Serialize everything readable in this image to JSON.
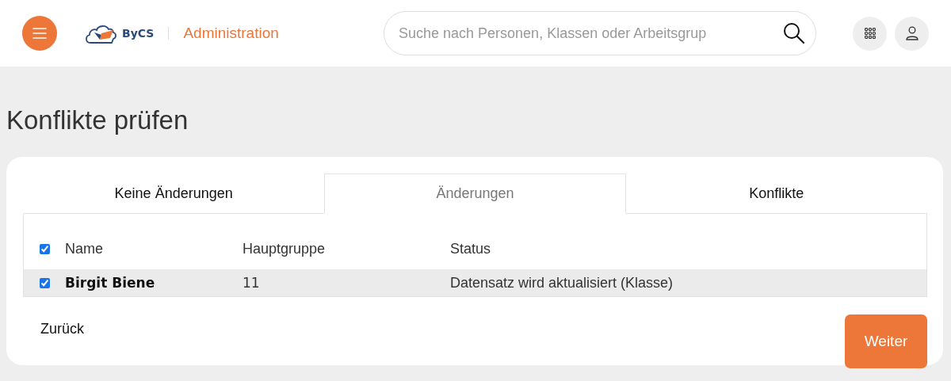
{
  "header": {
    "logo_text": "ByCS",
    "app_title": "Administration",
    "search": {
      "placeholder": "Suche nach Personen, Klassen oder Arbeitsgrup"
    }
  },
  "page_title": "Konflikte prüfen",
  "tabs": [
    {
      "label": "Keine Änderungen",
      "selected": false
    },
    {
      "label": "Änderungen",
      "selected": true
    },
    {
      "label": "Konflikte",
      "selected": false
    }
  ],
  "table": {
    "select_all": {
      "checked": true
    },
    "columns": [
      "Name",
      "Hauptgruppe",
      "Status"
    ],
    "rows": [
      {
        "checked": true,
        "cells": [
          "Birgit Biene",
          "11",
          "Datensatz wird aktualisiert (Klasse)"
        ]
      }
    ]
  },
  "buttons": {
    "back": "Zurück",
    "next": "Weiter"
  }
}
